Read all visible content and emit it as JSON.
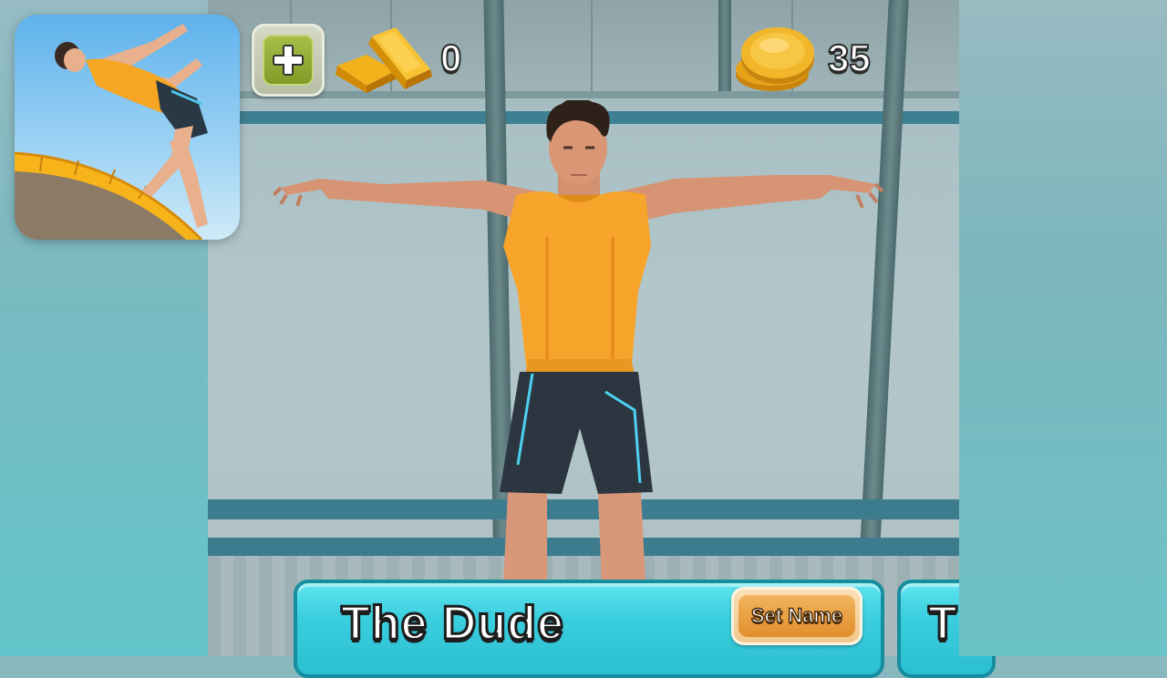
{
  "hud": {
    "gold_bars": "0",
    "coins": "35"
  },
  "character": {
    "name": "The Dude",
    "set_name_label": "Set Name",
    "next_card_initial": "T"
  },
  "icons": {
    "add": "plus-icon",
    "gold": "gold-bar-icon",
    "coin": "coin-stack-icon"
  },
  "colors": {
    "panel": "#39cddd",
    "shirt": "#f7a42a",
    "button": "#e8982f"
  }
}
